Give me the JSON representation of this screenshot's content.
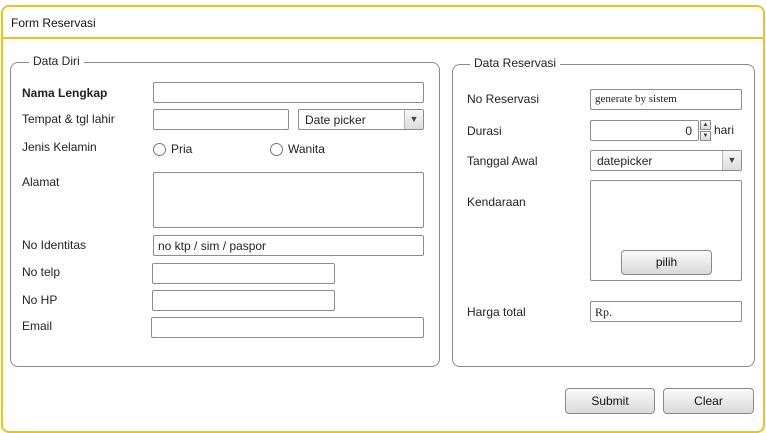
{
  "window": {
    "title": "Form Reservasi"
  },
  "data_diri": {
    "legend": "Data Diri",
    "nama_label": "Nama Lengkap",
    "nama_value": "",
    "ttl_label": "Tempat & tgl lahir",
    "tempat_value": "",
    "date_picker": "Date picker",
    "gender_label": "Jenis Kelamin",
    "gender_options": [
      "Pria",
      "Wanita"
    ],
    "alamat_label": "Alamat",
    "alamat_value": "",
    "identitas_label": "No Identitas",
    "identitas_value": "no ktp / sim / paspor",
    "telp_label": "No telp",
    "telp_value": "",
    "hp_label": "No HP",
    "hp_value": "",
    "email_label": "Email",
    "email_value": ""
  },
  "data_reservasi": {
    "legend": "Data Reservasi",
    "no_label": "No Reservasi",
    "no_value": "generate by sistem",
    "durasi_label": "Durasi",
    "durasi_value": "0",
    "durasi_unit": "hari",
    "tanggal_label": "Tanggal Awal",
    "tanggal_value": "datepicker",
    "kendaraan_label": "Kendaraan",
    "pilih_label": "pilih",
    "harga_label": "Harga total",
    "harga_value": "Rp."
  },
  "actions": {
    "submit_label": "Submit",
    "clear_label": "Clear"
  },
  "colors": {
    "frame_accent": "#f2c01e",
    "border": "#8c8c8c"
  },
  "icons": {
    "dropdown": "chevron-down-icon",
    "spinner": "spinner-icon"
  }
}
